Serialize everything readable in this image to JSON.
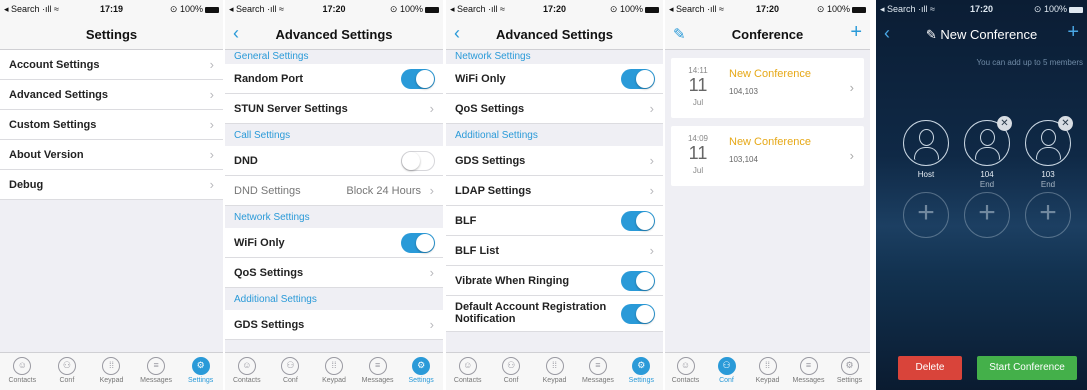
{
  "status": {
    "carrier": "Search",
    "battery_full": "100%",
    "times": [
      "17:19",
      "17:20",
      "17:20",
      "17:20",
      "17:20"
    ]
  },
  "tabs": [
    {
      "label": "Contacts",
      "icon": "contacts-icon"
    },
    {
      "label": "Conf",
      "icon": "conference-icon"
    },
    {
      "label": "Keypad",
      "icon": "keypad-icon"
    },
    {
      "label": "Messages",
      "icon": "messages-icon"
    },
    {
      "label": "Settings",
      "icon": "gear-icon"
    }
  ],
  "screen1": {
    "title": "Settings",
    "items": [
      "Account Settings",
      "Advanced Settings",
      "Custom Settings",
      "About Version",
      "Debug"
    ]
  },
  "screen2": {
    "title": "Advanced Settings",
    "sec_general": "General Settings",
    "random_port": "Random Port",
    "stun": "STUN Server Settings",
    "sec_call": "Call Settings",
    "dnd": "DND",
    "dnd_settings": "DND Settings",
    "dnd_value": "Block 24 Hours",
    "sec_network": "Network Settings",
    "wifi_only": "WiFi Only",
    "qos": "QoS Settings",
    "sec_additional": "Additional Settings",
    "gds": "GDS Settings"
  },
  "screen3": {
    "title": "Advanced Settings",
    "sec_network": "Network Settings",
    "wifi_only": "WiFi Only",
    "qos": "QoS Settings",
    "sec_additional": "Additional Settings",
    "gds": "GDS Settings",
    "ldap": "LDAP Settings",
    "blf": "BLF",
    "blf_list": "BLF List",
    "vibrate": "Vibrate When Ringing",
    "default_notif_line1": "Default Account Registration",
    "default_notif_line2": "Notification"
  },
  "screen4": {
    "title": "Conference",
    "conferences": [
      {
        "time": "14:11",
        "day": "11",
        "month": "Jul",
        "title": "New Conference",
        "members": "104,103"
      },
      {
        "time": "14:09",
        "day": "11",
        "month": "Jul",
        "title": "New Conference",
        "members": "103,104"
      }
    ]
  },
  "screen5": {
    "title": "New Conference",
    "hint": "You can add up to 5 members",
    "members": [
      {
        "name": "Host",
        "status": ""
      },
      {
        "name": "104",
        "status": "End"
      },
      {
        "name": "103",
        "status": "End"
      }
    ],
    "delete_label": "Delete",
    "start_label": "Start Conference"
  },
  "colors": {
    "accent": "#2a9ad8",
    "conference_title": "#e6a817",
    "delete": "#d9443a",
    "start": "#44b04a"
  }
}
